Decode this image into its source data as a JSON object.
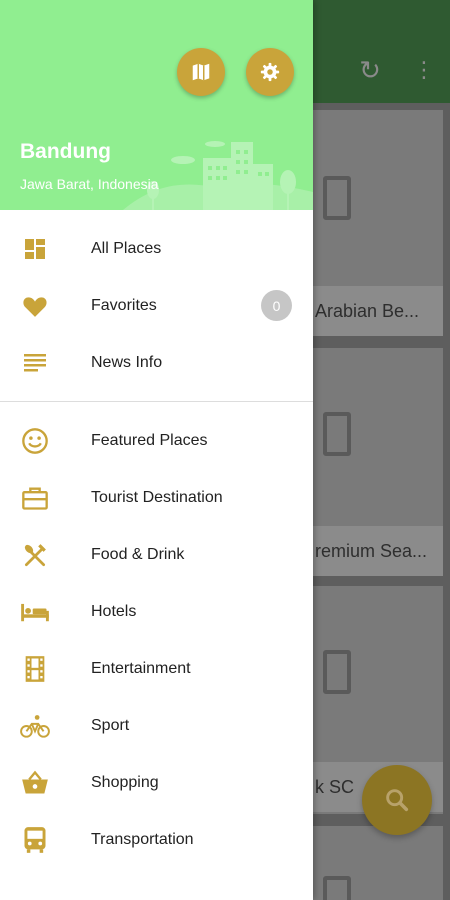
{
  "drawer": {
    "city": "Bandung",
    "region": "Jawa Barat, Indonesia",
    "header_color": "#90EE90",
    "accent": "#C9A43A",
    "primary_items": [
      {
        "label": "All Places",
        "icon": "grid-icon"
      },
      {
        "label": "Favorites",
        "icon": "heart-icon",
        "badge": "0"
      },
      {
        "label": "News Info",
        "icon": "news-icon"
      }
    ],
    "category_items": [
      {
        "label": "Featured Places",
        "icon": "smiley-icon"
      },
      {
        "label": "Tourist Destination",
        "icon": "briefcase-icon"
      },
      {
        "label": "Food & Drink",
        "icon": "utensils-icon"
      },
      {
        "label": "Hotels",
        "icon": "bed-icon"
      },
      {
        "label": "Entertainment",
        "icon": "film-icon"
      },
      {
        "label": "Sport",
        "icon": "bicycle-icon"
      },
      {
        "label": "Shopping",
        "icon": "basket-icon"
      },
      {
        "label": "Transportation",
        "icon": "bus-icon"
      }
    ]
  },
  "background": {
    "cards": [
      {
        "caption": "Arabian Be..."
      },
      {
        "caption": "remium Sea..."
      },
      {
        "caption": "k SC"
      }
    ]
  }
}
